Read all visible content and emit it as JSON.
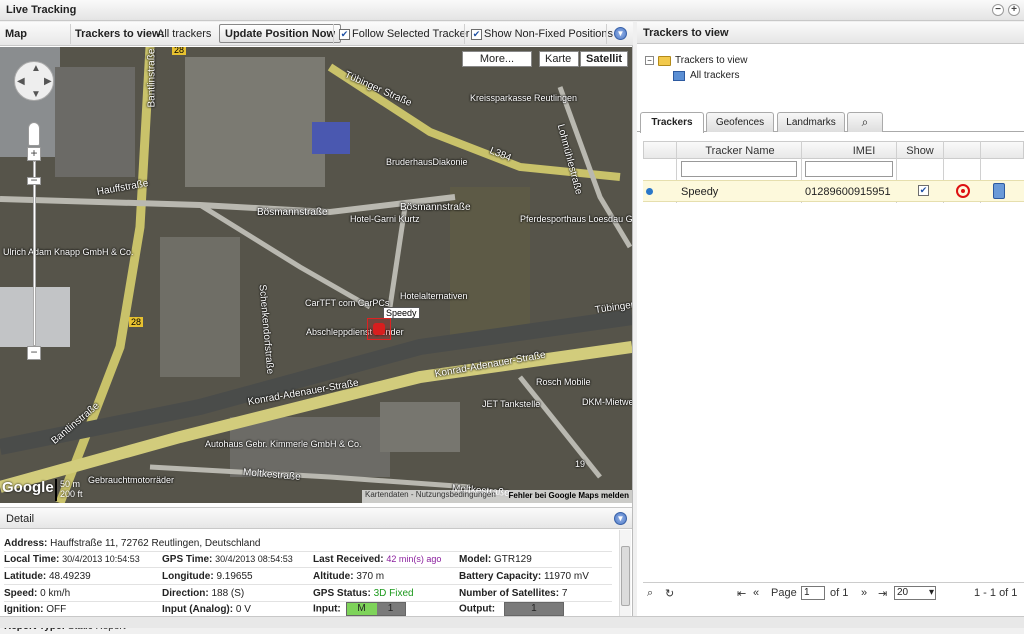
{
  "window": {
    "title": "Live Tracking",
    "minimize_label": "−",
    "maximize_label": "+"
  },
  "map_toolbar": {
    "map_label": "Map",
    "trackers_to_view_label": "Trackers to view:",
    "trackers_to_view_value": "All trackers",
    "update_button": "Update Position Now",
    "follow_selected": {
      "label": "Follow Selected Tracker",
      "checked": true
    },
    "show_non_fixed": {
      "label": "Show Non-Fixed Positions",
      "checked": true
    }
  },
  "map": {
    "type_buttons": {
      "more": "More...",
      "karte": "Karte",
      "satellit": "Satellit",
      "active": "Satellit"
    },
    "labels": [
      "Tübinger Straße",
      "Kreissparkasse Reutlingen",
      "BruderhausDiakonie",
      "L384",
      "Lohmühlestraße",
      "Bantlinstraße",
      "Hauffstraße",
      "Bösmannstraße",
      "Bösmannstraße",
      "Hotel-Garni Kurtz",
      "Pferdesporthaus Loesdau GmbH & Co.",
      "Ulrich Adam Knapp GmbH & Co.",
      "Schenkendorfstraße",
      "CarTFT com CarPCs",
      "Hotelalternativen",
      "Abschleppdienst Bender",
      "Tübinger",
      "Konrad-Adenauer-Straße",
      "Konrad-Adenauer-Straße",
      "Rosch Mobile",
      "JET Tankstelle",
      "DKM-Mietwer",
      "Bantlinstraße",
      "Autohaus Gebr. Kimmerle GmbH & Co.",
      "Moltkestraße",
      "Gebrauchtmotorräder",
      "Moltkestraße",
      "28",
      "28",
      "19"
    ],
    "tracker_label": "Speedy",
    "google_logo": "Google",
    "scale": {
      "metric": "50 m",
      "imperial": "200 ft"
    },
    "attribution": "Kartendaten - Nutzungsbedingungen",
    "report_error": "Fehler bei Google Maps melden"
  },
  "detail": {
    "header": "Detail",
    "address": {
      "label": "Address:",
      "value": "Hauffstraße 11, 72762 Reutlingen, Deutschland"
    },
    "local_time": {
      "label": "Local Time:",
      "value": "30/4/2013 10:54:53"
    },
    "gps_time": {
      "label": "GPS Time:",
      "value": "30/4/2013 08:54:53"
    },
    "last_received": {
      "label": "Last Received:",
      "value": "42 min(s) ago"
    },
    "model": {
      "label": "Model:",
      "value": "GTR129"
    },
    "latitude": {
      "label": "Latitude:",
      "value": "48.49239"
    },
    "longitude": {
      "label": "Longitude:",
      "value": "9.19655"
    },
    "altitude": {
      "label": "Altitude:",
      "value": "370 m"
    },
    "battery": {
      "label": "Battery Capacity:",
      "value": "11970 mV"
    },
    "speed": {
      "label": "Speed:",
      "value": "0 km/h"
    },
    "direction": {
      "label": "Direction:",
      "value": "188 (S)"
    },
    "gps_status": {
      "label": "GPS Status:",
      "value": "3D Fixed"
    },
    "satellites": {
      "label": "Number of Satellites:",
      "value": "7"
    },
    "ignition": {
      "label": "Ignition:",
      "value": "OFF"
    },
    "input_analog": {
      "label": "Input (Analog):",
      "value": "0 V"
    },
    "input": {
      "label": "Input:",
      "m": "M",
      "one": "1"
    },
    "output": {
      "label": "Output:",
      "one": "1"
    },
    "report_type": {
      "label": "Report Type:",
      "value": "Static Report"
    }
  },
  "right": {
    "header": "Trackers to view",
    "tree": {
      "root": "Trackers to view",
      "child": "All trackers"
    },
    "tabs": [
      "Trackers",
      "Geofences",
      "Landmarks"
    ],
    "active_tab": "Trackers",
    "grid": {
      "columns": [
        "Tracker Name",
        "IMEI",
        "Show"
      ],
      "rows": [
        {
          "name": "Speedy",
          "imei": "01289600915951",
          "show": true
        }
      ]
    },
    "pager": {
      "page_label": "Page",
      "page_value": "1",
      "of_label": "of 1",
      "page_size": "20",
      "summary": "1 - 1 of 1"
    }
  },
  "colors": {
    "accent": "#4a77c6",
    "gps_fixed": "#1d9a1d",
    "last_received": "#8b1f9e",
    "selected_row": "#fdf9dc",
    "input_on": "#7ed35a"
  }
}
